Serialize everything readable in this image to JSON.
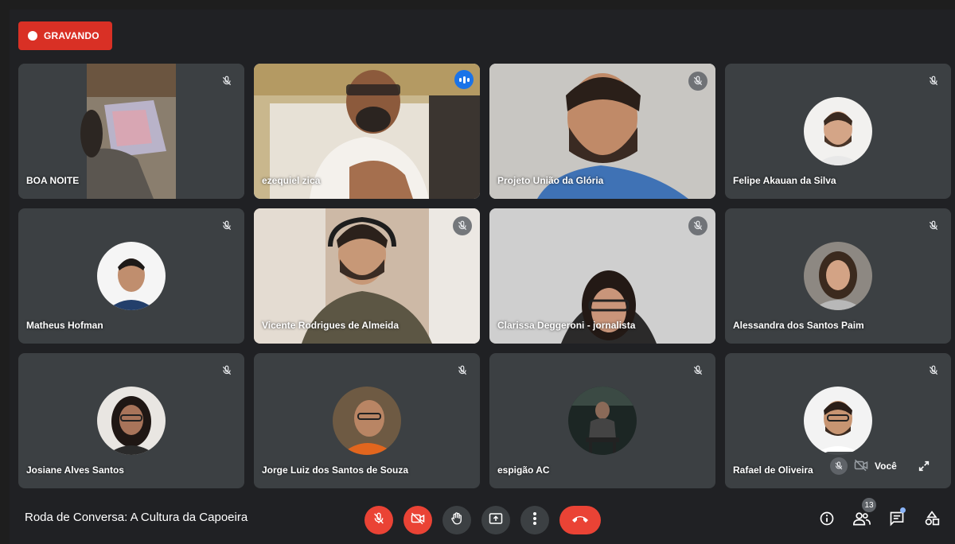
{
  "recording": {
    "label": "GRAVANDO"
  },
  "meeting": {
    "title": "Roda de Conversa: A Cultura da Capoeira"
  },
  "self_view": {
    "label": "Você"
  },
  "participants_count": "13",
  "colors": {
    "tile_bg": "#3c4043",
    "stage_bg": "#202124",
    "recording_red": "#d93025",
    "control_red": "#ea4335",
    "speaking_blue": "#8ab4f8"
  },
  "tiles": [
    {
      "name": "BOA NOITE",
      "type": "video",
      "muted": true
    },
    {
      "name": "ezequiel zica",
      "type": "video",
      "speaking": true
    },
    {
      "name": "Projeto União da Glória",
      "type": "video",
      "muted": true
    },
    {
      "name": "Felipe Akauan da Silva",
      "type": "avatar",
      "muted": true
    },
    {
      "name": "Matheus Hofman",
      "type": "avatar",
      "muted": true
    },
    {
      "name": "Vicente Rodrigues de Almeida",
      "type": "video",
      "muted": true
    },
    {
      "name": "Clarissa Deggeroni - jornalista",
      "type": "video",
      "muted": true
    },
    {
      "name": "Alessandra dos Santos Paim",
      "type": "avatar",
      "muted": true
    },
    {
      "name": "Josiane Alves Santos",
      "type": "avatar",
      "muted": true
    },
    {
      "name": "Jorge Luiz dos Santos de Souza",
      "type": "avatar",
      "muted": true
    },
    {
      "name": "espigão AC",
      "type": "avatar",
      "muted": true
    },
    {
      "name": "Rafael de Oliveira",
      "type": "avatar",
      "muted": true
    }
  ],
  "controls": [
    {
      "name": "mic-off-button",
      "icon": "mic-off-icon"
    },
    {
      "name": "camera-off-button",
      "icon": "camera-off-icon"
    },
    {
      "name": "raise-hand-button",
      "icon": "hand-icon"
    },
    {
      "name": "present-button",
      "icon": "present-icon"
    },
    {
      "name": "more-options-button",
      "icon": "more-vert-icon"
    },
    {
      "name": "leave-call-button",
      "icon": "phone-hangup-icon"
    }
  ],
  "right_controls": [
    {
      "name": "meeting-info-button",
      "icon": "info-icon"
    },
    {
      "name": "participants-button",
      "icon": "people-icon"
    },
    {
      "name": "chat-button",
      "icon": "chat-icon"
    },
    {
      "name": "activities-button",
      "icon": "shapes-icon"
    }
  ]
}
